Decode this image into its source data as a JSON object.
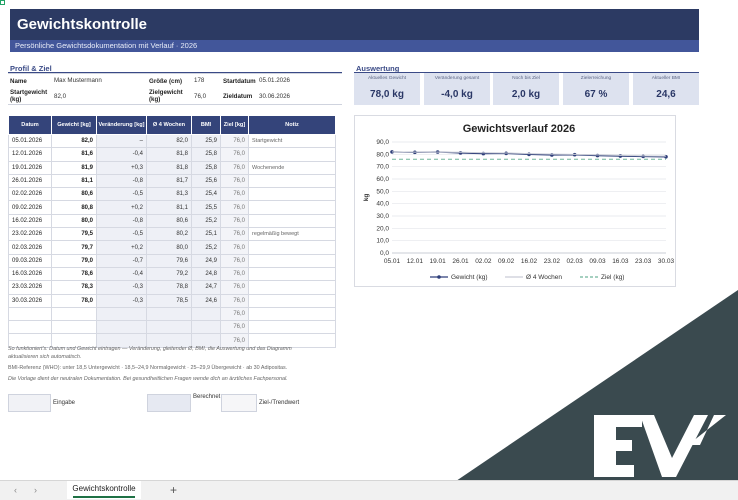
{
  "header": {
    "title": "Gewichtskontrolle",
    "subtitle": "Persönliche Gewichtsdokumentation mit Verlauf · 2026"
  },
  "profile": {
    "section_title": "Profil & Ziel",
    "name_label": "Name",
    "name_value": "Max Mustermann",
    "height_label": "Größe (cm)",
    "height_value": "178",
    "start_date_label": "Startdatum",
    "start_date_value": "05.01.2026",
    "start_weight_label": "Startgewicht (kg)",
    "start_weight_value": "82,0",
    "goal_weight_label": "Zielgewicht (kg)",
    "goal_weight_value": "76,0",
    "goal_date_label": "Zieldatum",
    "goal_date_value": "30.06.2026"
  },
  "evaluation": {
    "section_title": "Auswertung",
    "cards": [
      {
        "label": "Aktuelles Gewicht",
        "value": "78,0 kg"
      },
      {
        "label": "Veränderung gesamt",
        "value": "-4,0 kg"
      },
      {
        "label": "Noch bis Ziel",
        "value": "2,0 kg"
      },
      {
        "label": "Zielerreichung",
        "value": "67 %"
      },
      {
        "label": "Aktueller BMI",
        "value": "24,6"
      }
    ]
  },
  "table": {
    "headers": [
      "Datum",
      "Gewicht [kg]",
      "Veränderung [kg]",
      "Ø 4 Wochen",
      "BMI",
      "Ziel [kg]",
      "Notiz"
    ],
    "rows": [
      [
        "05.01.2026",
        "82,0",
        "–",
        "82,0",
        "25,9",
        "76,0",
        "Startgewicht"
      ],
      [
        "12.01.2026",
        "81,6",
        "-0,4",
        "81,8",
        "25,8",
        "76,0",
        ""
      ],
      [
        "19.01.2026",
        "81,9",
        "+0,3",
        "81,8",
        "25,8",
        "76,0",
        "Wochenende"
      ],
      [
        "26.01.2026",
        "81,1",
        "-0,8",
        "81,7",
        "25,6",
        "76,0",
        ""
      ],
      [
        "02.02.2026",
        "80,6",
        "-0,5",
        "81,3",
        "25,4",
        "76,0",
        ""
      ],
      [
        "09.02.2026",
        "80,8",
        "+0,2",
        "81,1",
        "25,5",
        "76,0",
        ""
      ],
      [
        "16.02.2026",
        "80,0",
        "-0,8",
        "80,6",
        "25,2",
        "76,0",
        ""
      ],
      [
        "23.02.2026",
        "79,5",
        "-0,5",
        "80,2",
        "25,1",
        "76,0",
        "regelmäßig bewegt"
      ],
      [
        "02.03.2026",
        "79,7",
        "+0,2",
        "80,0",
        "25,2",
        "76,0",
        ""
      ],
      [
        "09.03.2026",
        "79,0",
        "-0,7",
        "79,6",
        "24,9",
        "76,0",
        ""
      ],
      [
        "16.03.2026",
        "78,6",
        "-0,4",
        "79,2",
        "24,8",
        "76,0",
        ""
      ],
      [
        "23.03.2026",
        "78,3",
        "-0,3",
        "78,8",
        "24,7",
        "76,0",
        ""
      ],
      [
        "30.03.2026",
        "78,0",
        "-0,3",
        "78,5",
        "24,6",
        "76,0",
        ""
      ],
      [
        "",
        "",
        "",
        "",
        "",
        "76,0",
        ""
      ],
      [
        "",
        "",
        "",
        "",
        "",
        "76,0",
        ""
      ],
      [
        "",
        "",
        "",
        "",
        "",
        "76,0",
        ""
      ]
    ]
  },
  "chart_data": {
    "type": "line",
    "title": "Gewichtsverlauf 2026",
    "xlabel": "",
    "ylabel": "kg",
    "categories": [
      "05.01",
      "12.01",
      "19.01",
      "26.01",
      "02.02",
      "09.02",
      "16.02",
      "23.02",
      "02.03",
      "09.03",
      "16.03",
      "23.03",
      "30.03"
    ],
    "series": [
      {
        "name": "Gewicht (kg)",
        "values": [
          82.0,
          81.6,
          81.9,
          81.1,
          80.6,
          80.8,
          80.0,
          79.5,
          79.7,
          79.0,
          78.6,
          78.3,
          78.0
        ],
        "color": "#2f3f7a",
        "style": "solid-markers"
      },
      {
        "name": "Ø 4 Wochen",
        "values": [
          82.0,
          81.8,
          81.8,
          81.7,
          81.3,
          81.1,
          80.6,
          80.2,
          80.0,
          79.6,
          79.2,
          78.8,
          78.5
        ],
        "color": "#c9ccd6",
        "style": "solid"
      },
      {
        "name": "Ziel (kg)",
        "values": [
          76.0,
          76.0,
          76.0,
          76.0,
          76.0,
          76.0,
          76.0,
          76.0,
          76.0,
          76.0,
          76.0,
          76.0,
          76.0
        ],
        "color": "#6fb59a",
        "style": "dashed"
      }
    ],
    "ylim": [
      0,
      90
    ],
    "yticks": [
      "0,0",
      "10,0",
      "20,0",
      "30,0",
      "40,0",
      "50,0",
      "60,0",
      "70,0",
      "80,0",
      "90,0"
    ],
    "grid": true,
    "legend": "bottom"
  },
  "notes": {
    "line1": "So funktioniert's: Datum und Gewicht eintragen — Veränderung, gleitender Ø, BMI, die Auswertung und das Diagramm",
    "line2": "aktualisieren sich automatisch.",
    "line3": "BMI-Referenz (WHO): unter 18,5 Untergewicht · 18,5–24,9 Normalgewicht · 25–29,9 Übergewicht · ab 30 Adipositas.",
    "line4": "Die Vorlage dient der neutralen Dokumentation. Bei gesundheitlichen Fragen wende dich an ärztliches Fachpersonal."
  },
  "legend_keys": {
    "input": "Eingabe",
    "calculated": "Berechnet",
    "goal": "Ziel-/Trendwert"
  },
  "tabs": {
    "prev_arrow": "‹",
    "next_arrow": "›",
    "active_sheet": "Gewichtskontrolle",
    "add_sheet": "+"
  },
  "colors": {
    "header": "#2c3a63",
    "subheader": "#42569a",
    "kpi_card": "#dde2ef",
    "table_header": "#34447a",
    "calc_cell": "#eef0f6",
    "overlay": "#3a4a4f"
  }
}
